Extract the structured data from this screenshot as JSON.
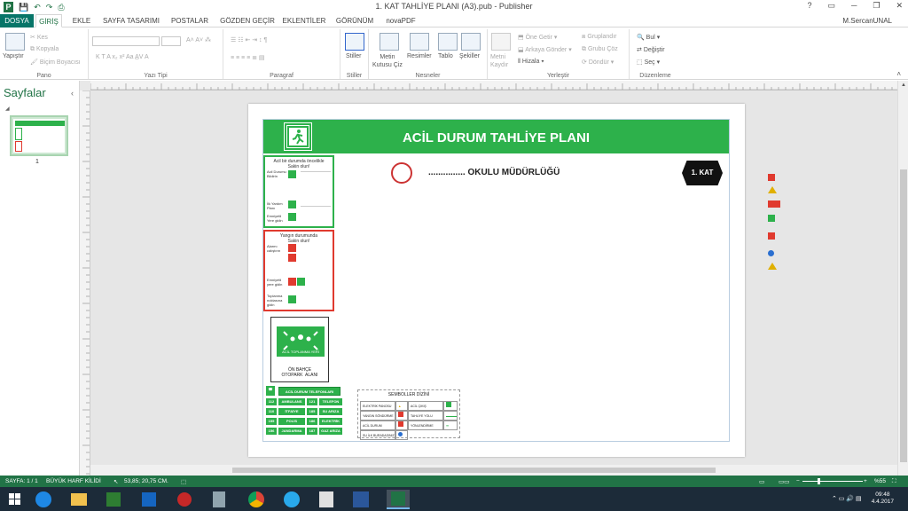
{
  "window": {
    "title": "1. KAT TAHLİYE PLANI (A3).pub - Publisher",
    "help": "?",
    "min": "─",
    "restore": "❐",
    "close": "✕"
  },
  "tabs": [
    {
      "label": "DOSYA"
    },
    {
      "label": "GİRİŞ"
    },
    {
      "label": "EKLE"
    },
    {
      "label": "SAYFA TASARIMI"
    },
    {
      "label": "POSTALAR"
    },
    {
      "label": "GÖZDEN GEÇİR"
    },
    {
      "label": "EKLENTİLER"
    },
    {
      "label": "GÖRÜNÜM"
    },
    {
      "label": "novaPDF"
    }
  ],
  "user": "M.SercanUNAL",
  "ribbon": {
    "pano": {
      "paste": "Yapıştır",
      "cut": "Kes",
      "copy": "Kopyala",
      "format_painter": "Biçim Boyacısı",
      "group": "Pano"
    },
    "font": {
      "group": "Yazı Tipi"
    },
    "paragraph": {
      "group": "Paragraf"
    },
    "styles": {
      "label": "Stiller",
      "group": "Stiller"
    },
    "objects": {
      "textbox": "Metin\nKutusu Çiz",
      "pictures": "Resimler",
      "table": "Tablo",
      "shapes": "Şekiller",
      "group": "Nesneler"
    },
    "arrange": {
      "wrap": "Metni\nKaydır",
      "bring_forward": "Öne Getir",
      "send_backward": "Arkaya Gönder",
      "align": "Hizala",
      "group_btn": "Gruplandır",
      "ungroup": "Grubu Çöz",
      "rotate": "Döndür",
      "group": "Yerleştir"
    },
    "editing": {
      "find": "Bul",
      "replace": "Değiştir",
      "select": "Seç",
      "group": "Düzenleme"
    }
  },
  "navpane": {
    "title": "Sayfalar",
    "close": "‹",
    "page_num": "1"
  },
  "poster": {
    "title": "ACİL DURUM TAHLİYE PLANI",
    "school": "............... OKULU MÜDÜRLÜĞÜ",
    "floor": "1. KAT",
    "box1_title": "Acil bir durumda öncelikle\nSakin olun!",
    "box1_rows": [
      "Acil Durumu\nBildirin",
      "İlk Yardım\nPlanı",
      "Emniyetli\nYere gidin"
    ],
    "box2_title": "Yangın durumunda\nSakin olun!",
    "box2_rows": [
      "Alarmı\ncalıştırın",
      "Emniyetli\nyere gidin",
      "Toplanma\nnoktasına\ngidin"
    ],
    "gather_label": "ACİL TOPLANMA YERİ",
    "gather_caption": "ÖN BAHÇE\nOTOPARK  ALANI",
    "phones_title": "ACİL DURUM TELEFONLARI",
    "phones": [
      {
        "n": "112",
        "name": "AMBULANS",
        "n2": "121",
        "name2": "TELEFON ARIZA"
      },
      {
        "n": "110",
        "name": "İTFAİYE",
        "n2": "185",
        "name2": "SU ARIZA"
      },
      {
        "n": "155",
        "name": "POLİS",
        "n2": "186",
        "name2": "ELEKTRİK ARIZA"
      },
      {
        "n": "156",
        "name": "JANDARMA",
        "n2": "187",
        "name2": "GAZ ARIZA"
      }
    ],
    "legend_title": "SEMBOLLER DİZİNİ",
    "legend": [
      "ELEKTRİK PANOSU",
      "ACİL ÇIKIŞ",
      "YANGIN SÖNDÜRME",
      "TAHLİYE YOLU",
      "ACİL DURUM",
      "YÖNLENDİRME",
      "SU İLK BURADASINIZ",
      ""
    ]
  },
  "status": {
    "page": "SAYFA: 1 / 1",
    "caps": "BÜYÜK HARF KİLİDİ",
    "pos": "53,85; 20,75 CM.",
    "zoom": "%55"
  },
  "clock": {
    "time": "09:48",
    "date": "4.4.2017"
  },
  "colors": {
    "accent": "#217346",
    "poster_green": "#2db14b",
    "red": "#e03a2f"
  }
}
